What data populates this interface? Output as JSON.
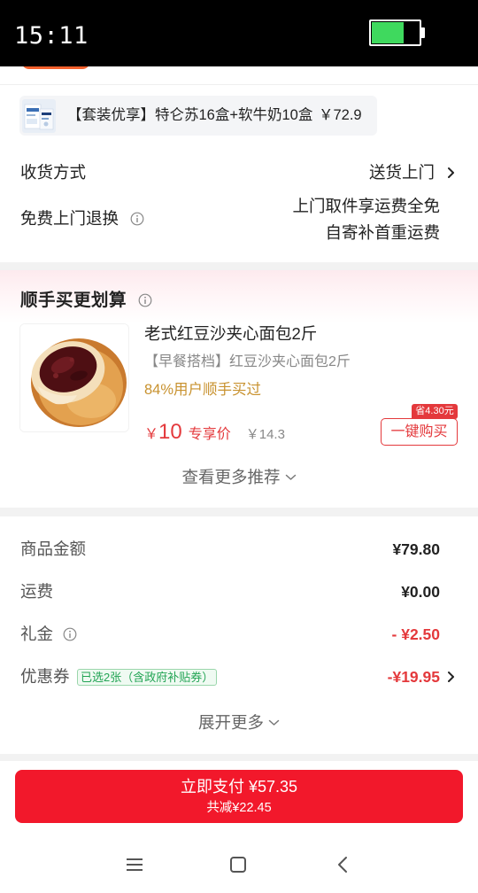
{
  "colors": {
    "price_red": "#e4393c",
    "pay_red": "#f2182b",
    "gold": "#c8922f",
    "coupon_green": "#22a454",
    "battery_green": "#3fd95e"
  },
  "status_bar": {
    "time": "15:11",
    "battery_level": 0.65
  },
  "bundle_banner": {
    "thumbnail": "milk-box-thumbnail",
    "name": "【套装优享】特仑苏16盒+软牛奶10盒",
    "price": "￥72.9"
  },
  "delivery": {
    "label": "收货方式",
    "value": "送货上门"
  },
  "returns": {
    "label": "免费上门退换",
    "line1": "上门取件享运费全免",
    "line2": "自寄补首重运费"
  },
  "add_on": {
    "title": "顺手买更划算",
    "product": {
      "image": "red-bean-bread-photo",
      "title": "老式红豆沙夹心面包2斤",
      "subtitle": "【早餐搭档】红豆沙夹心面包2斤",
      "social_proof": "84%用户顺手买过",
      "currency": "￥",
      "price": "10",
      "price_label": "专享价",
      "original_price": "￥14.3",
      "save_badge": "省4.30元",
      "buy_label": "一键购买"
    },
    "see_more": "查看更多推荐"
  },
  "price_summary": {
    "rows": [
      {
        "label": "商品金额",
        "value": "¥79.80"
      },
      {
        "label": "运费",
        "value": "¥0.00"
      },
      {
        "label": "礼金",
        "value": "- ¥2.50"
      },
      {
        "label": "优惠券",
        "tag": "已选2张（含政府补贴券）",
        "value": "-¥19.95"
      }
    ],
    "expand": "展开更多"
  },
  "pay_button": {
    "label": "立即支付 ¥57.35",
    "discount": "共减¥22.45"
  },
  "nav_bar": {
    "icons": [
      "menu-icon",
      "home-icon",
      "back-icon"
    ]
  }
}
